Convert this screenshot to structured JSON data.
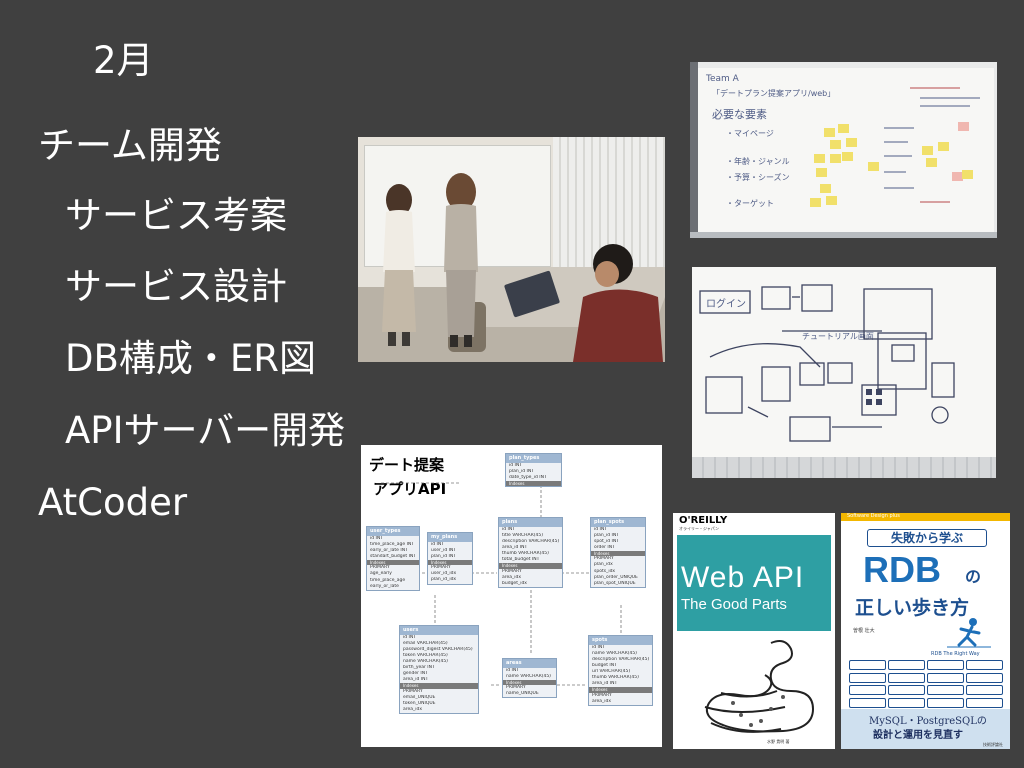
{
  "slide": {
    "month": "2月",
    "items": [
      "チーム開発",
      "サービス考案",
      "サービス設計",
      "DB構成・ER図",
      "APIサーバー開発",
      "AtCoder"
    ]
  },
  "er_diagram": {
    "caption_line1": "デート提案",
    "caption_line2": "アプリAPI",
    "tables": {
      "plan_types": {
        "name": "plan_types",
        "rows": [
          "id INT",
          "plan_id INT",
          "date_type_id INT"
        ],
        "index": "Indexes"
      },
      "plans": {
        "name": "plans",
        "rows": [
          "id INT",
          "title VARCHAR(45)",
          "description VARCHAR(45)",
          "area_id INT",
          "thumb VARCHAR(45)",
          "total_budget INT"
        ],
        "index": "Indexes",
        "keys": [
          "PRIMARY",
          "area_idx",
          "budget_idx"
        ]
      },
      "plan_spots": {
        "name": "plan_spots",
        "rows": [
          "id INT",
          "plan_id INT",
          "spot_id INT",
          "order INT"
        ],
        "index": "Indexes",
        "keys": [
          "PRIMARY",
          "plan_idx",
          "spots_idx",
          "plan_order_UNIQUE",
          "plan_spot_UNIQUE"
        ]
      },
      "user_types": {
        "name": "user_types",
        "rows": [
          "id INT",
          "time_place_age INT",
          "early_or_late INT",
          "standart_budget INT"
        ],
        "index": "Indexes",
        "keys": [
          "PRIMARY",
          "age_early",
          "time_place_age",
          "early_or_late"
        ]
      },
      "my_plans": {
        "name": "my_plans",
        "rows": [
          "id INT",
          "user_id INT",
          "plan_id INT"
        ],
        "index": "Indexes",
        "keys": [
          "PRIMARY",
          "user_id_idx",
          "plan_id_idx"
        ]
      },
      "users": {
        "name": "users",
        "rows": [
          "id INT",
          "email VARCHAR(45)",
          "password_digest VARCHAR(45)",
          "token VARCHAR(45)",
          "name VARCHAR(45)",
          "birth_year INT",
          "gender INT",
          "area_id INT"
        ],
        "index": "Indexes",
        "keys": [
          "PRIMARY",
          "email_UNIQUE",
          "token_UNIQUE",
          "area_idx"
        ]
      },
      "areas": {
        "name": "areas",
        "rows": [
          "id INT",
          "name VARCHAR(45)"
        ],
        "index": "Indexes",
        "keys": [
          "PRIMARY",
          "name_UNIQUE"
        ]
      },
      "spots": {
        "name": "spots",
        "rows": [
          "id INT",
          "name VARCHAR(45)",
          "description VARCHAR(45)",
          "budget INT",
          "url VARCHAR(45)",
          "thumb VARCHAR(45)",
          "area_id INT"
        ],
        "index": "Indexes",
        "keys": [
          "PRIMARY",
          "area_idx"
        ]
      }
    }
  },
  "whiteboard1": {
    "heading": "Team A",
    "line1": "「デートプラン提案アプリ/web」",
    "line2": "必要な要素",
    "notes": [
      "・マイページ",
      "・年齢・ジャンル",
      "・予算・シーズン",
      "・ターゲット"
    ]
  },
  "whiteboard2": {
    "label1": "ログイン",
    "label2": "チュートリアル画面"
  },
  "book_webapi": {
    "publisher": "O'REILLY",
    "publisher_sub": "オライリー・ジャパン",
    "title_line1": "Web API",
    "title_line2": "The Good Parts",
    "author": "水野 貴明 著"
  },
  "book_rdb": {
    "series": "Software Design plus",
    "subtitle": "失敗から学ぶ",
    "title_main": "RDB",
    "title_no": "の",
    "title_rest": "正しい歩き方",
    "author": "曽根 壮大",
    "english": "RDB The Right Way",
    "footer_line1": "MySQL・PostgreSQLの",
    "footer_line2": "設計と運用を見直す",
    "publisher": "技術評論社"
  },
  "colors": {
    "background": "#404040",
    "text": "#ffffff",
    "oreilly_teal": "#2e9fa3",
    "rdb_blue": "#1d6fb8"
  }
}
